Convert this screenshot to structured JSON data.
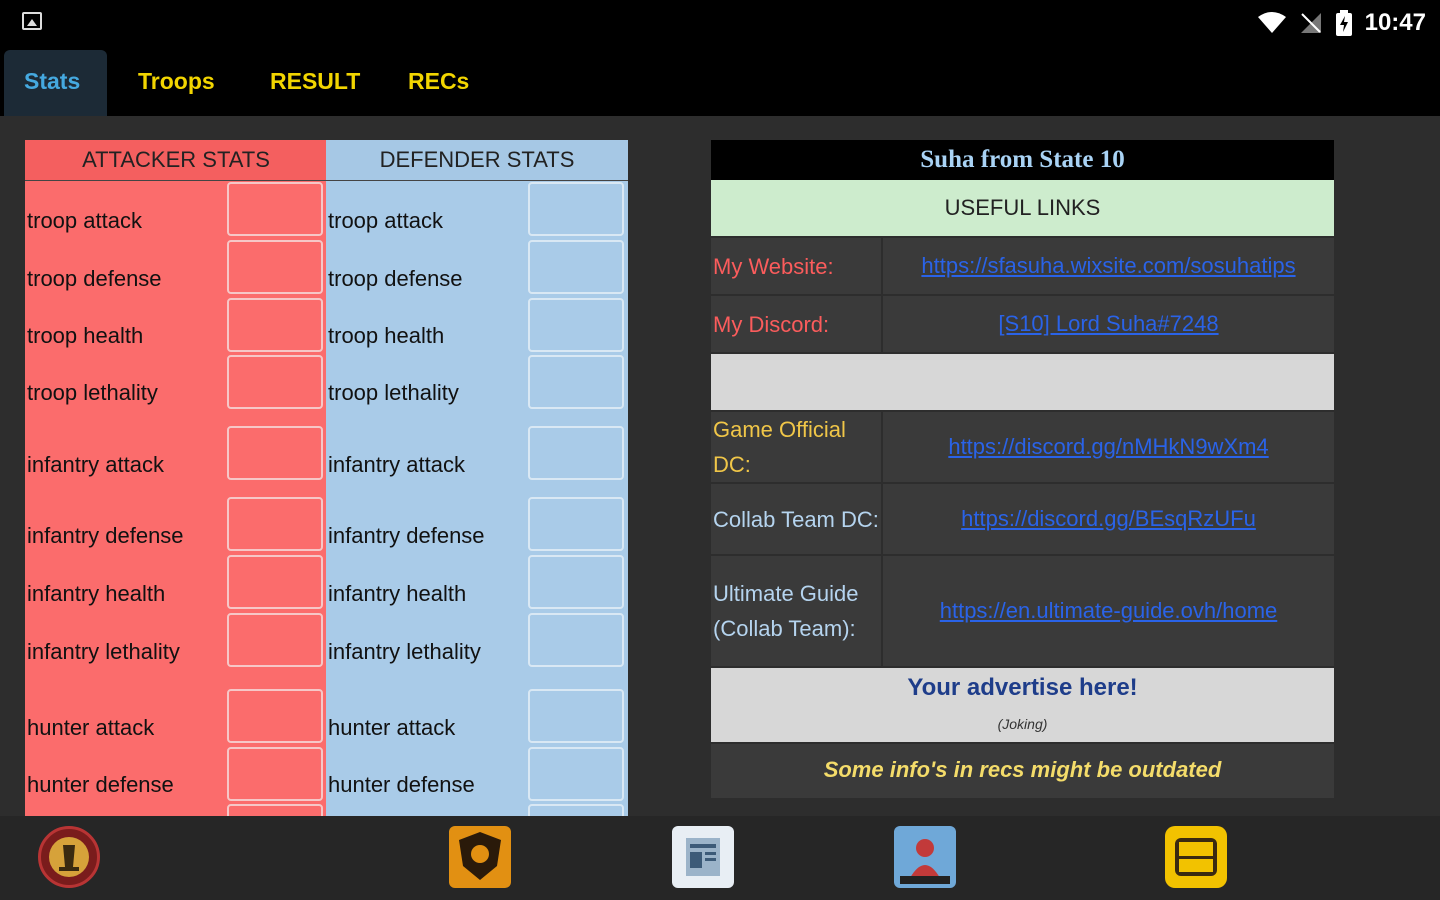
{
  "status": {
    "time": "10:47"
  },
  "tabs": [
    {
      "label": "Stats"
    },
    {
      "label": "Troops"
    },
    {
      "label": "RESULT"
    },
    {
      "label": "RECs"
    }
  ],
  "attacker": {
    "header": "ATTACKER STATS",
    "rows": [
      "troop attack",
      "troop defense",
      "troop health",
      "troop lethality",
      "infantry attack",
      "infantry defense",
      "infantry health",
      "infantry lethality",
      "hunter attack",
      "hunter defense"
    ]
  },
  "defender": {
    "header": "DEFENDER STATS",
    "rows": [
      "troop attack",
      "troop defense",
      "troop health",
      "troop lethality",
      "infantry attack",
      "infantry defense",
      "infantry health",
      "infantry lethality",
      "hunter attack",
      "hunter defense"
    ]
  },
  "panel": {
    "title": "Suha from State 10",
    "useful_links": "USEFUL LINKS",
    "website_label": "My Website:",
    "website_value": "https://sfasuha.wixsite.com/sosuhatips",
    "discord_label": "My Discord:",
    "discord_value": "[S10] Lord Suha#7248",
    "official_label": "Game Official DC:",
    "official_value": "https://discord.gg/nMHkN9wXm4",
    "collab_label": "Collab Team DC:",
    "collab_value": "https://discord.gg/BEsqRzUFu",
    "guide_label": "Ultimate Guide (Collab Team):",
    "guide_value": "https://en.ultimate-guide.ovh/home",
    "advert_main": "Your advertise here!",
    "advert_sub": "(Joking)",
    "note": "Some info's in recs might be outdated"
  },
  "colors": {
    "attacker": "#fb6c6c",
    "defender": "#a9cbe8",
    "tab_active": "#45a9e0",
    "tab_inactive": "#f2d500"
  }
}
